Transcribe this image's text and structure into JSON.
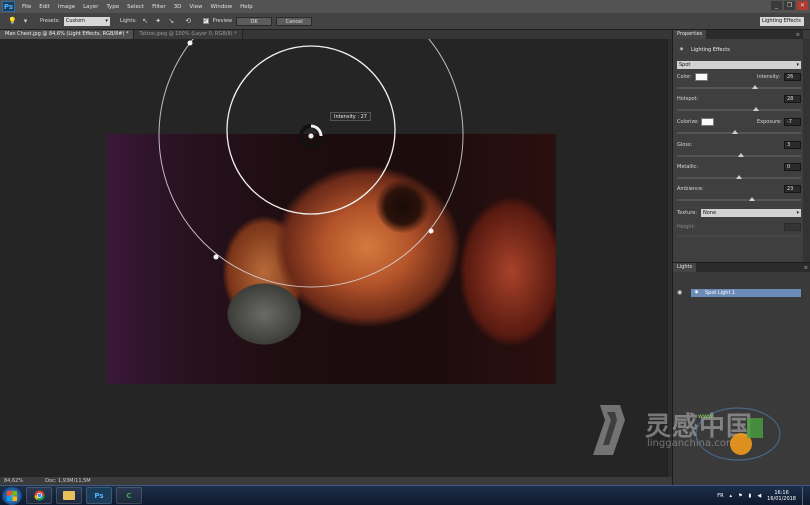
{
  "app": {
    "logo": "Ps"
  },
  "menu": [
    "File",
    "Edit",
    "Image",
    "Layer",
    "Type",
    "Select",
    "Filter",
    "3D",
    "View",
    "Window",
    "Help"
  ],
  "window_controls": [
    "_",
    "❐",
    "✕"
  ],
  "options_bar": {
    "presets_label": "Presets:",
    "presets_value": "Custom",
    "lights_label": "Lights:",
    "preview_label": "Preview",
    "ok_label": "OK",
    "cancel_label": "Cancel",
    "workspace": "Lighting Effects"
  },
  "tabs": [
    {
      "label": "Man Chest.jpg @ 84,6% (Light Effects, RGB/8#) *"
    },
    {
      "label": "Tattoo.jpeg @ 100% (Layer 0, RGB/8) *"
    }
  ],
  "canvas": {
    "intensity_tooltip": "Intensity : 27"
  },
  "status": {
    "zoom": "84,62%",
    "doc": "Doc: 1,93M/11,5M"
  },
  "properties": {
    "tab": "Properties",
    "title": "Lighting Effects",
    "light_type": "Spot",
    "color_label": "Color:",
    "intensity_label": "Intensity:",
    "intensity": "26",
    "intensity_level": 0.63,
    "hotspot_label": "Hotspot:",
    "hotspot": "28",
    "hotspot_level": 0.64,
    "colorize_label": "Colorize:",
    "exposure_label": "Exposure:",
    "exposure": "-7",
    "exposure_level": 0.47,
    "gloss_label": "Gloss:",
    "gloss": "3",
    "gloss_level": 0.52,
    "metallic_label": "Metallic:",
    "metallic": "0",
    "metallic_level": 0.5,
    "ambience_label": "Ambience:",
    "ambience": "23",
    "ambience_level": 0.61,
    "texture_label": "Texture:",
    "texture": "None",
    "height_label": "Height:"
  },
  "lights_panel": {
    "tab": "Lights",
    "item": "Spot Light 1"
  },
  "taskbar": {
    "apps": [
      "chrome",
      "explorer",
      "Ps",
      "C"
    ],
    "lang": "FR",
    "time": "16:16",
    "date": "16/01/2018"
  },
  "watermark": {
    "cn": "灵感中国",
    "en": "lingganchina.com"
  },
  "colors": {
    "accent": "#6b8cb8",
    "ps_blue": "#4fb2ff"
  }
}
